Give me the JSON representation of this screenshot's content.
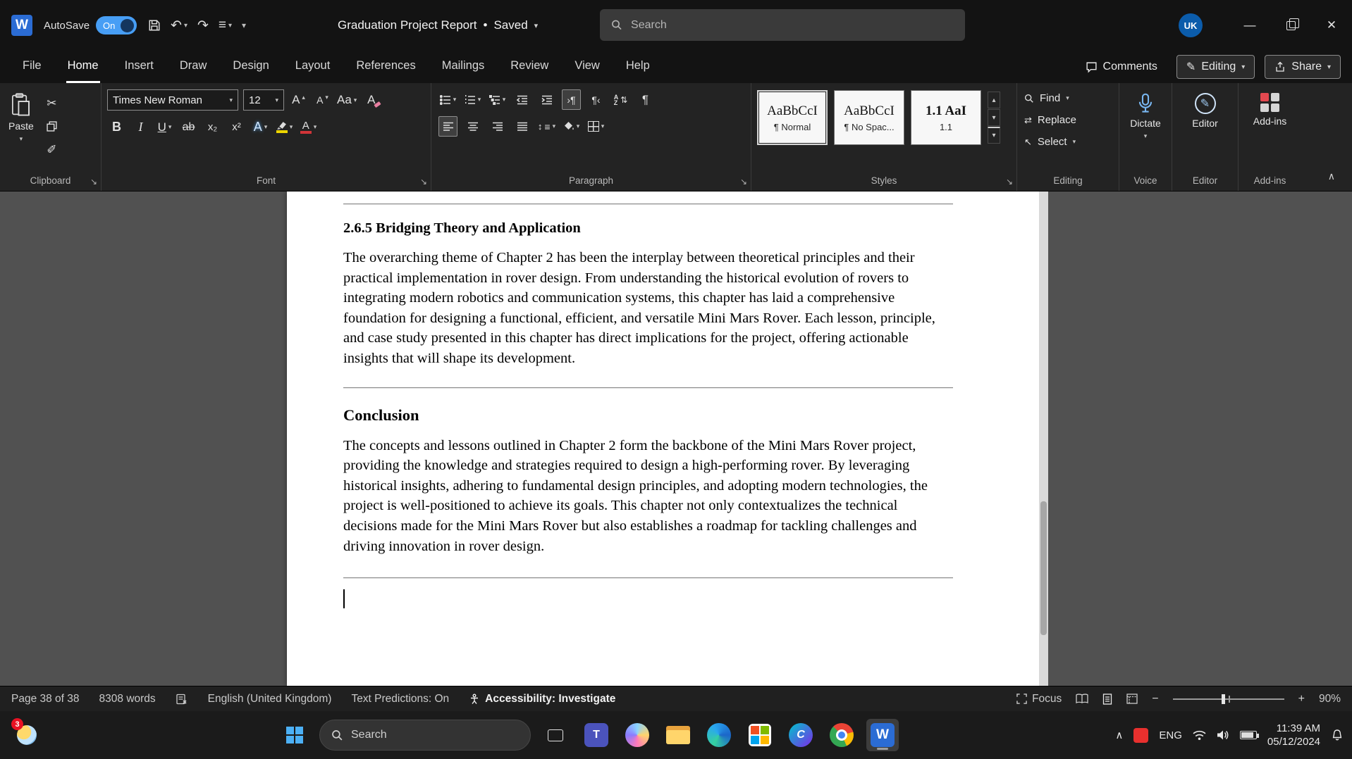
{
  "titlebar": {
    "app": "Word",
    "autosave_label": "AutoSave",
    "autosave_state": "On",
    "doc_title": "Graduation Project Report",
    "doc_status_sep": "•",
    "doc_status": "Saved",
    "search_placeholder": "Search",
    "avatar_initials": "UK"
  },
  "menubar": {
    "items": [
      "File",
      "Home",
      "Insert",
      "Draw",
      "Design",
      "Layout",
      "References",
      "Mailings",
      "Review",
      "View",
      "Help"
    ],
    "active_item": "Home",
    "comments_label": "Comments",
    "editing_label": "Editing",
    "share_label": "Share"
  },
  "ribbon": {
    "clipboard": {
      "group_label": "Clipboard",
      "paste_label": "Paste"
    },
    "font": {
      "group_label": "Font",
      "font_name": "Times New Roman",
      "font_size": "12",
      "grow": "A",
      "shrink": "A",
      "case": "Aa",
      "clear": "A",
      "bold": "B",
      "italic": "I",
      "underline": "U",
      "strikethrough": "ab",
      "subscript": "x₂",
      "superscript": "x²",
      "effects": "A",
      "fontcolor": "A"
    },
    "paragraph": {
      "group_label": "Paragraph",
      "ltr": "›¶",
      "rtl": "¶‹"
    },
    "styles": {
      "group_label": "Styles",
      "items": [
        {
          "preview": "AaBbCcI",
          "name": "¶ Normal"
        },
        {
          "preview": "AaBbCcI",
          "name": "¶ No Spac..."
        },
        {
          "preview": "1.1 AaI",
          "name": "1.1"
        }
      ]
    },
    "editing": {
      "group_label": "Editing",
      "find": "Find",
      "replace": "Replace",
      "select": "Select"
    },
    "voice": {
      "group_label": "Voice",
      "dictate": "Dictate"
    },
    "editor": {
      "group_label": "Editor",
      "button": "Editor"
    },
    "addins": {
      "group_label": "Add-ins",
      "button": "Add-ins"
    }
  },
  "document": {
    "section_heading": "2.6.5 Bridging Theory and Application",
    "section_body": "The overarching theme of Chapter 2 has been the interplay between theoretical principles and their practical implementation in rover design. From understanding the historical evolution of rovers to integrating modern robotics and communication systems, this chapter has laid a comprehensive foundation for designing a functional, efficient, and versatile Mini Mars Rover. Each lesson, principle, and case study presented in this chapter has direct implications for the project, offering actionable insights that will shape its development.",
    "conclusion_heading": "Conclusion",
    "conclusion_body": "The concepts and lessons outlined in Chapter 2 form the backbone of the Mini Mars Rover project, providing the knowledge and strategies required to design a high-performing rover. By leveraging historical insights, adhering to fundamental design principles, and adopting modern technologies, the project is well-positioned to achieve its goals. This chapter not only contextualizes the technical decisions made for the Mini Mars Rover but also establishes a roadmap for tackling challenges and driving innovation in rover design."
  },
  "statusbar": {
    "page_info": "Page 38 of 38",
    "word_count": "8308 words",
    "language": "English (United Kingdom)",
    "predictions": "Text Predictions: On",
    "accessibility": "Accessibility: Investigate",
    "focus_label": "Focus",
    "zoom_level": "90%"
  },
  "taskbar": {
    "widgets_badge": "3",
    "search_placeholder": "Search",
    "language": "ENG",
    "time": "11:39 AM",
    "date": "05/12/2024"
  },
  "icons": {
    "dropdown": "▾",
    "up": "▴",
    "undo": "↶",
    "redo": "↷",
    "scissors": "✂",
    "painter": "✐",
    "pilcrow": "¶",
    "close": "✕",
    "minimize": "—",
    "collapse": "∧",
    "swap": "⇄",
    "select_arrow": "↖",
    "sort_arrow": "⇅",
    "spacing": "↕",
    "lines": "≡",
    "launcher": "↘",
    "word_letter": "W",
    "teams_letter": "T",
    "canva_letter": "C",
    "pencil": "✎",
    "sort_a": "A",
    "sort_z": "Z"
  },
  "colors": {
    "toggle_blue": "#479ef5",
    "word_blue": "#2b6cd4",
    "highlight_yellow": "#edd500",
    "font_color_red": "#d13438",
    "avatar_blue": "#0b5cab",
    "badge_red": "#e81123"
  }
}
